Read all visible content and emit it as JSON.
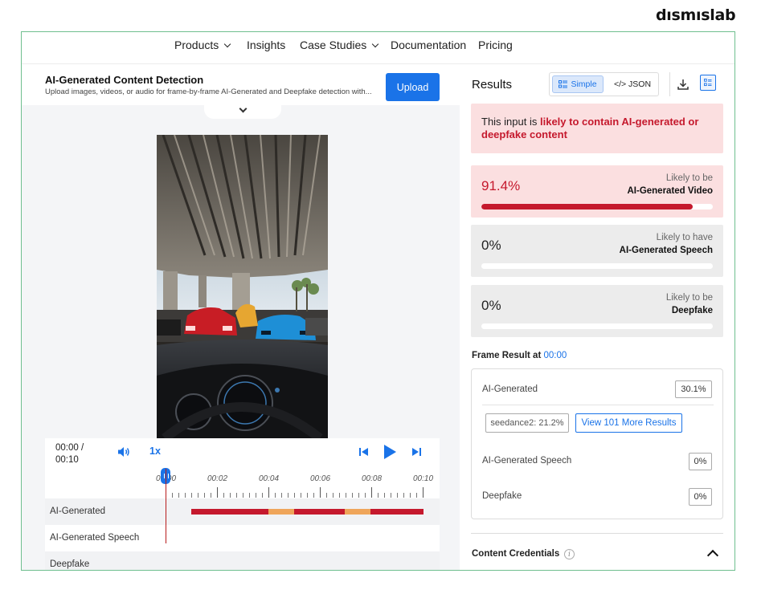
{
  "brand": "dısmıslab",
  "nav": {
    "items": [
      {
        "label": "Products",
        "dropdown": true
      },
      {
        "label": "Insights",
        "dropdown": false
      },
      {
        "label": "Case Studies",
        "dropdown": true
      },
      {
        "label": "Documentation",
        "dropdown": false
      },
      {
        "label": "Pricing",
        "dropdown": false
      }
    ]
  },
  "header": {
    "title": "AI-Generated Content Detection",
    "description": "Upload images, videos, or audio for frame-by-frame AI-Generated and Deepfake detection with...",
    "upload_label": "Upload"
  },
  "player": {
    "time_current": "00:00 /",
    "time_total": "00:10",
    "speed": "1x",
    "ticks": [
      "00:00",
      "00:02",
      "00:04",
      "00:06",
      "00:08",
      "00:10"
    ],
    "playhead_fraction": 0.0
  },
  "timeline": {
    "tracks": [
      {
        "label": "AI-Generated"
      },
      {
        "label": "AI-Generated Speech"
      },
      {
        "label": "Deepfake"
      }
    ]
  },
  "results": {
    "title": "Results",
    "view_simple": "Simple",
    "view_json": "</> JSON",
    "alert_prefix": "This input is ",
    "alert_highlight": "likely to contain AI-generated or deepfake content",
    "scores": [
      {
        "value": "91.4%",
        "sub": "Likely to be",
        "main": "AI-Generated Video",
        "fraction": 0.914
      },
      {
        "value": "0%",
        "sub": "Likely to have",
        "main": "AI-Generated Speech",
        "fraction": 0.0
      },
      {
        "value": "0%",
        "sub": "Likely to be",
        "main": "Deepfake",
        "fraction": 0.0
      }
    ],
    "frame_result_label": "Frame Result at",
    "frame_result_time": "00:00",
    "frame": {
      "ai_label": "AI-Generated",
      "ai_value": "30.1%",
      "model_chip": "seedance2: 21.2%",
      "more_button": "View 101 More Results",
      "speech_label": "AI-Generated Speech",
      "speech_value": "0%",
      "deepfake_label": "Deepfake",
      "deepfake_value": "0%"
    },
    "content_credentials": "Content Credentials",
    "info_glyph": "i"
  },
  "colors": {
    "accent": "#1a73e8",
    "danger": "#c5192d",
    "warning": "#efa55a",
    "alert_bg": "#fbdfe0",
    "frame_border": "#6fbf8f"
  },
  "icons": {
    "volume": "volume-icon",
    "prev": "skip-previous-icon",
    "play": "play-icon",
    "next": "skip-next-icon",
    "download": "download-icon",
    "panel": "panel-layout-icon",
    "list": "list-icon"
  }
}
